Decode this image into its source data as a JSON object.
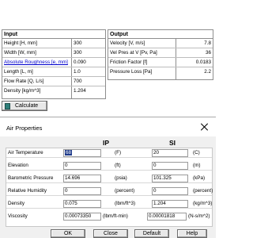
{
  "input": {
    "header": "Input",
    "rows": [
      {
        "label": "Height [H, mm]",
        "value": "300",
        "is_link": false
      },
      {
        "label": "Width [W, mm]",
        "value": "300",
        "is_link": false
      },
      {
        "label": "Absolute Roughness [e, mm]",
        "value": "0.090",
        "is_link": true
      },
      {
        "label": "Length [L, m]",
        "value": "1.0",
        "is_link": false
      },
      {
        "label": "Flow Rate [Q, L/s]",
        "value": "700",
        "is_link": false
      },
      {
        "label": "Density [kg/m^3]",
        "value": "1.204",
        "is_link": false
      }
    ]
  },
  "output": {
    "header": "Output",
    "rows": [
      {
        "label": "Velocity [V, m/s]",
        "value": "7.8"
      },
      {
        "label": "Vel Pres at V [Pv, Pa]",
        "value": "36"
      },
      {
        "label": "Friction Factor [f]",
        "value": "0.0183"
      },
      {
        "label": "Pressure Loss [Pa]",
        "value": "2.2"
      }
    ]
  },
  "calculate_button": {
    "label": "Calculate"
  },
  "dialog": {
    "title": "Air Properties",
    "col_ip": "IP",
    "col_si": "SI",
    "rows": [
      {
        "label": "Air Temperature",
        "ip_value": "68",
        "ip_unit": "(F)",
        "si_value": "20",
        "si_unit": "(C)"
      },
      {
        "label": "Elevation",
        "ip_value": "0",
        "ip_unit": "(ft)",
        "si_value": "0",
        "si_unit": "(m)"
      },
      {
        "label": "Barometric Pressure",
        "ip_value": "14.696",
        "ip_unit": "(psia)",
        "si_value": "101.325",
        "si_unit": "(kPa)"
      },
      {
        "label": "Relative Humidity",
        "ip_value": "0",
        "ip_unit": "(percent)",
        "si_value": "0",
        "si_unit": "(percent)"
      },
      {
        "label": "Density",
        "ip_value": "0.075",
        "ip_unit": "(lbm/ft^3)",
        "si_value": "1.204",
        "si_unit": "(kg/m^3)"
      },
      {
        "label": "Viscosity",
        "ip_value": "0.00073350",
        "ip_unit": "(lbm/ft-min)",
        "si_value": "0.00001818",
        "si_unit": "(N-s/m^2)"
      }
    ],
    "buttons": {
      "ok": "OK",
      "close": "Close",
      "default": "Default",
      "help": "Help"
    }
  }
}
